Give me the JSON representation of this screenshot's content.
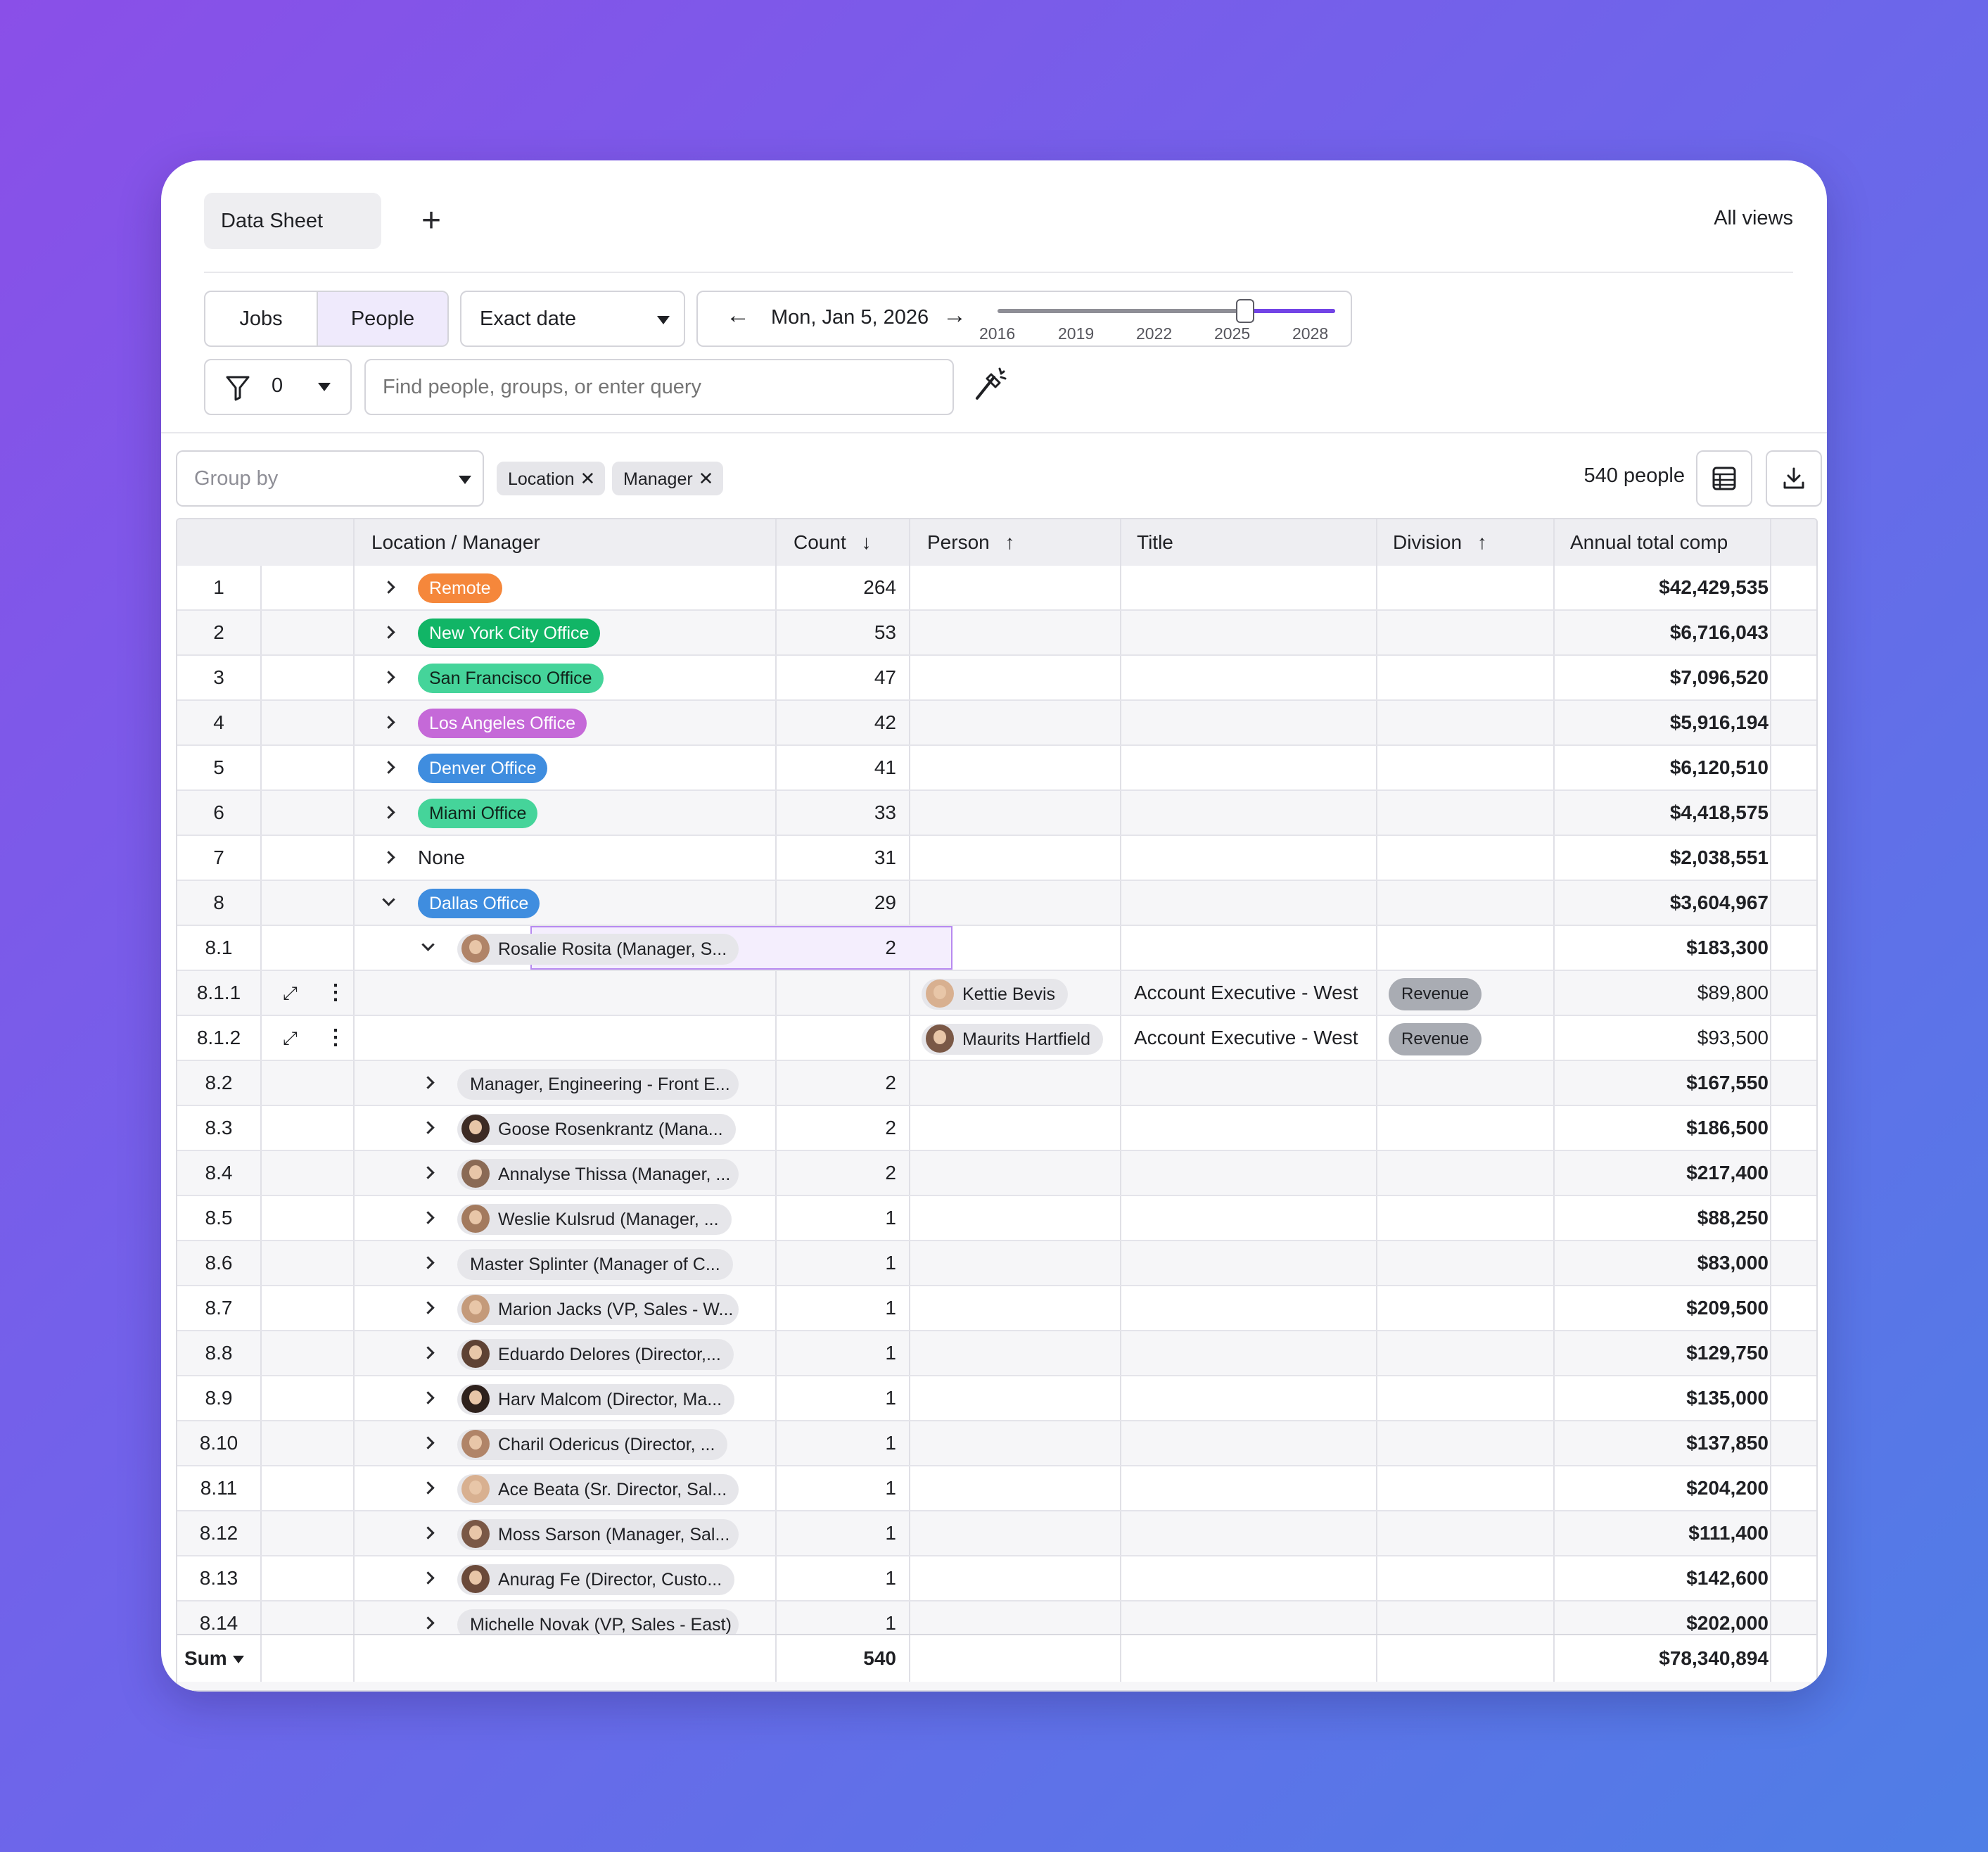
{
  "tabs": {
    "active": "Data Sheet",
    "add": "+",
    "all_views": "All views"
  },
  "toggle": {
    "jobs": "Jobs",
    "people": "People"
  },
  "date_mode": "Exact date",
  "date": {
    "prev": "←",
    "label": "Mon, Jan 5, 2026",
    "next": "→",
    "years": [
      "2016",
      "2019",
      "2022",
      "2025",
      "2028"
    ]
  },
  "filter": {
    "count": "0"
  },
  "search": {
    "placeholder": "Find people, groups, or enter query"
  },
  "group_by": {
    "placeholder": "Group by",
    "chips": [
      "Location",
      "Manager"
    ],
    "remove": "✕"
  },
  "people_count": "540 people",
  "columns": {
    "location_manager": "Location / Manager",
    "count": "Count",
    "person": "Person",
    "title": "Title",
    "division": "Division",
    "comp": "Annual total comp",
    "sort_down": "↓",
    "sort_up": "↑"
  },
  "colors": {
    "remote": "#f5873b",
    "nyc": "#11b566",
    "sf": "#45d49a",
    "la": "#c569d8",
    "denver": "#3f8ddf",
    "miami": "#45d49a",
    "dallas": "#3f8ddf",
    "accent": "#7244e6"
  },
  "rows": [
    {
      "num": "1",
      "label": "Remote",
      "count": "264",
      "comp": "$42,429,535"
    },
    {
      "num": "2",
      "label": "New York City Office",
      "count": "53",
      "comp": "$6,716,043"
    },
    {
      "num": "3",
      "label": "San Francisco Office",
      "count": "47",
      "comp": "$7,096,520"
    },
    {
      "num": "4",
      "label": "Los Angeles Office",
      "count": "42",
      "comp": "$5,916,194"
    },
    {
      "num": "5",
      "label": "Denver Office",
      "count": "41",
      "comp": "$6,120,510"
    },
    {
      "num": "6",
      "label": "Miami Office",
      "count": "33",
      "comp": "$4,418,575"
    },
    {
      "num": "7",
      "label": "None",
      "count": "31",
      "comp": "$2,038,551"
    },
    {
      "num": "8",
      "label": "Dallas Office",
      "count": "29",
      "comp": "$3,604,967"
    },
    {
      "num": "8.1",
      "label": "Rosalie Rosita (Manager, S...",
      "count": "2",
      "comp": "$183,300"
    },
    {
      "num": "8.1.1",
      "person": "Kettie Bevis",
      "title": "Account Executive - West",
      "division": "Revenue",
      "comp": "$89,800"
    },
    {
      "num": "8.1.2",
      "person": "Maurits Hartfield",
      "title": "Account Executive - West",
      "division": "Revenue",
      "comp": "$93,500"
    },
    {
      "num": "8.2",
      "label": "Manager, Engineering - Front E...",
      "count": "2",
      "comp": "$167,550"
    },
    {
      "num": "8.3",
      "label": "Goose Rosenkrantz (Mana...",
      "count": "2",
      "comp": "$186,500"
    },
    {
      "num": "8.4",
      "label": "Annalyse Thissa (Manager, ...",
      "count": "2",
      "comp": "$217,400"
    },
    {
      "num": "8.5",
      "label": "Weslie Kulsrud (Manager, ...",
      "count": "1",
      "comp": "$88,250"
    },
    {
      "num": "8.6",
      "label": "Master Splinter (Manager of C...",
      "count": "1",
      "comp": "$83,000"
    },
    {
      "num": "8.7",
      "label": "Marion Jacks (VP, Sales - W...",
      "count": "1",
      "comp": "$209,500"
    },
    {
      "num": "8.8",
      "label": "Eduardo Delores (Director,...",
      "count": "1",
      "comp": "$129,750"
    },
    {
      "num": "8.9",
      "label": "Harv Malcom (Director, Ma...",
      "count": "1",
      "comp": "$135,000"
    },
    {
      "num": "8.10",
      "label": "Charil Odericus (Director, ...",
      "count": "1",
      "comp": "$137,850"
    },
    {
      "num": "8.11",
      "label": "Ace Beata (Sr. Director, Sal...",
      "count": "1",
      "comp": "$204,200"
    },
    {
      "num": "8.12",
      "label": "Moss Sarson (Manager, Sal...",
      "count": "1",
      "comp": "$111,400"
    },
    {
      "num": "8.13",
      "label": "Anurag Fe (Director, Custo...",
      "count": "1",
      "comp": "$142,600"
    },
    {
      "num": "8.14",
      "label": "Michelle Novak (VP, Sales - East)",
      "count": "1",
      "comp": "$202,000"
    }
  ],
  "sum": {
    "label": "Sum",
    "count": "540",
    "comp": "$78,340,894"
  }
}
